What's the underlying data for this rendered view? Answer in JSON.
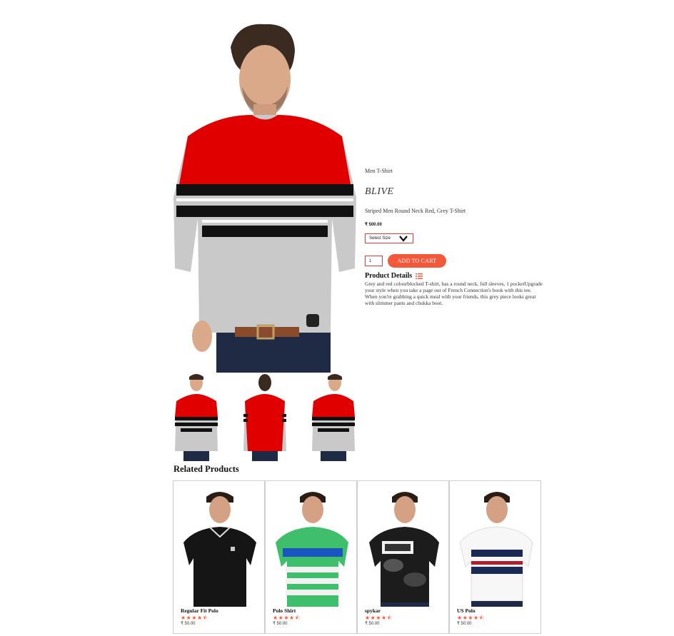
{
  "product": {
    "category": "Men T-Shirt",
    "brand": "BLIVE",
    "subtitle": "Striped Men Round Neck Red, Grey T-Shirt",
    "price": "₹ 500.00",
    "size_placeholder": "Select Size",
    "quantity": "1",
    "add_to_cart_label": "ADD TO CART",
    "details_heading": "Product Details",
    "details_text": "Grey and red colourblocked T-shirt, has a round neck, full sleeves, 1 pocketUpgrade your style when you take a page out of French Connection's book with this tee. When you're grabbing a quick meal with your friends, this grey piece looks great with slimmer pants and chukka boot."
  },
  "colors": {
    "accent": "#f4583b",
    "border_red": "#e53935",
    "shirt_red": "#e10000",
    "shirt_grey": "#c9c9c9",
    "stripe_black": "#111111"
  },
  "related": {
    "heading": "Related Products",
    "items": [
      {
        "name": "Regular Fit Polo",
        "stars": "★★★★⯪",
        "price": "₹ 50.00",
        "shirt": "black-polo"
      },
      {
        "name": "Polo Shirt",
        "stars": "★★★★⯪",
        "price": "₹ 50.00",
        "shirt": "green-striped-polo"
      },
      {
        "name": "spykar",
        "stars": "★★★★⯪",
        "price": "₹ 50.00",
        "shirt": "camo-graphic-tee"
      },
      {
        "name": "US Polo",
        "stars": "★★★★⯪",
        "price": "₹ 50.00",
        "shirt": "white-navy-polo"
      }
    ]
  }
}
